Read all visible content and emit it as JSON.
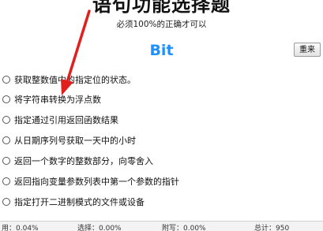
{
  "header": {
    "title": "语句功能选择题",
    "subtitle": "必须100%的正确才可以"
  },
  "app": {
    "name": "Bit",
    "name_color": "#1e90ff"
  },
  "toolbar": {
    "reset_label": "重来"
  },
  "options": [
    {
      "label": "获取整数值中的指定位的状态。"
    },
    {
      "label": "将字符串转换为浮点数"
    },
    {
      "label": "指定通过引用返回函数结果"
    },
    {
      "label": "从日期序列号获取一天中的小时"
    },
    {
      "label": "返回一个数字的整数部分，向零舍入"
    },
    {
      "label": "返回指向变量参数列表中第一个参数的指针"
    },
    {
      "label": "指定打开二进制模式的文件或设备"
    }
  ],
  "annotation": {
    "arrow_color": "#e0201c"
  },
  "statusbar": {
    "item1": "用：0.04%",
    "item2": "选择：0.00%",
    "item3": "附写：0.00%",
    "item4": "总计：950"
  }
}
